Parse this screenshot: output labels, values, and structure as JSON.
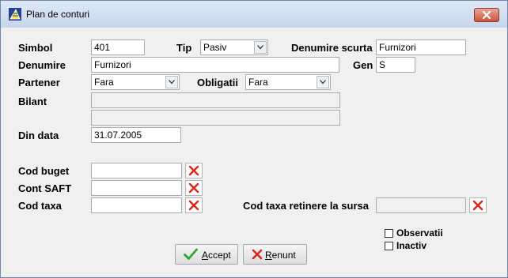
{
  "window": {
    "title": "Plan de conturi"
  },
  "fields": {
    "simbol": {
      "label": "Simbol",
      "value": "401"
    },
    "tip": {
      "label": "Tip",
      "value": "Pasiv"
    },
    "denumire_scurta": {
      "label": "Denumire scurta",
      "value": "Furnizori"
    },
    "denumire": {
      "label": "Denumire",
      "value": "Furnizori"
    },
    "gen": {
      "label": "Gen",
      "value": "S"
    },
    "partener": {
      "label": "Partener",
      "value": "Fara"
    },
    "obligatii": {
      "label": "Obligatii",
      "value": "Fara"
    },
    "bilant": {
      "label": "Bilant",
      "value1": "",
      "value2": ""
    },
    "din_data": {
      "label": "Din data",
      "value": "31.07.2005"
    },
    "cod_buget": {
      "label": "Cod buget",
      "value": ""
    },
    "cont_saft": {
      "label": "Cont SAFT",
      "value": ""
    },
    "cod_taxa": {
      "label": "Cod taxa",
      "value": ""
    },
    "cod_taxa_retinere": {
      "label": "Cod taxa retinere la sursa",
      "value": ""
    }
  },
  "checkboxes": {
    "observatii": {
      "label": "Observatii",
      "checked": false
    },
    "inactiv": {
      "label": "Inactiv",
      "checked": false
    }
  },
  "buttons": {
    "accept": {
      "mnemonic": "A",
      "rest": "ccept"
    },
    "renunt": {
      "mnemonic": "R",
      "rest": "enunt"
    }
  },
  "icons": {
    "clear": "red-x-icon",
    "accept": "green-check-icon",
    "renunt": "red-x-icon",
    "dropdown": "chevron-down-icon"
  }
}
